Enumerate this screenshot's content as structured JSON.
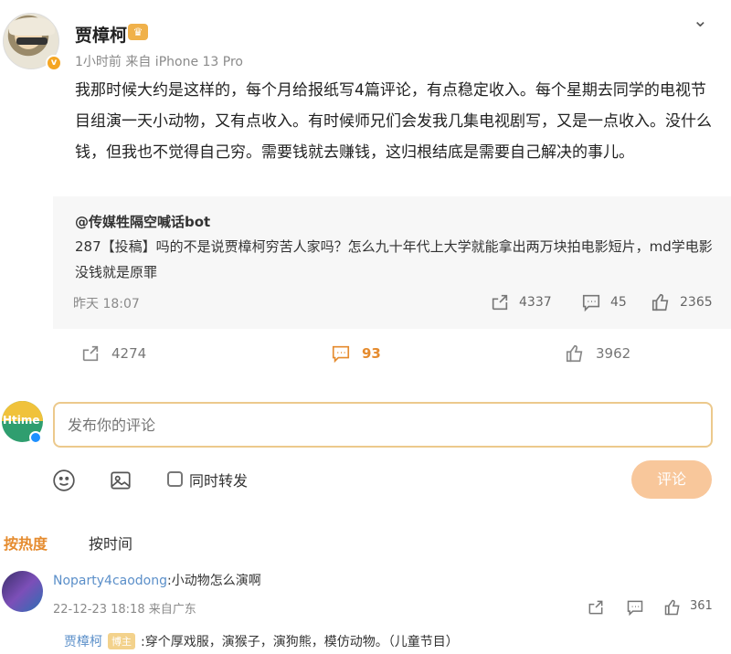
{
  "post": {
    "author": "贾樟柯",
    "meta": "1小时前  来自 iPhone 13 Pro",
    "text": "我那时候大约是这样的，每个月给报纸写4篇评论，有点稳定收入。每个星期去同学的电视节目组演一天小动物，又有点收入。有时候师兄们会发我几集电视剧写，又是一点收入。没什么钱，但我也不觉得自己穷。需要钱就去赚钱，这归根结底是需要自己解决的事儿。",
    "actions": {
      "reposts": "4274",
      "comments": "93",
      "likes": "3962"
    }
  },
  "repost": {
    "author": "@传媒牲隔空喊话bot",
    "text": "287【投稿】吗的不是说贾樟柯穷苦人家吗？怎么九十年代上大学就能拿出两万块拍电影短片，md学电影没钱就是原罪",
    "time": "昨天 18:07",
    "stats": {
      "reposts": "4337",
      "comments": "45",
      "likes": "2365"
    }
  },
  "composer": {
    "avatar_text": "Htime",
    "placeholder": "发布你的评论",
    "repost_label": "同时转发",
    "submit_label": "评论"
  },
  "tabs": {
    "hot": "按热度",
    "time": "按时间"
  },
  "comment": {
    "name": "Noparty4caodong",
    "text": ":小动物怎么演啊",
    "time": "22-12-23 18:18  来自广东",
    "likes": "361",
    "reply": {
      "name": "贾樟柯",
      "tag": "博主",
      "text": ":穿个厚戏服，演猴子，演狗熊，模仿动物。（儿童节目）"
    }
  },
  "colors": {
    "accent": "#e58b2e",
    "link": "#5b8fc9",
    "button": "#f8c79b"
  },
  "icons": [
    "chevron-down-icon",
    "repost-icon",
    "comment-icon",
    "like-icon",
    "emoji-icon",
    "image-icon"
  ]
}
